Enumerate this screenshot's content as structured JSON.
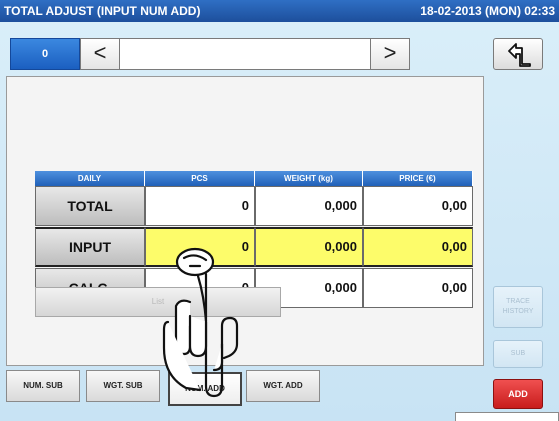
{
  "window": {
    "title": "TOTAL ADJUST (INPUT NUM ADD)",
    "datetime": "18-02-2013 (MON)  02:33"
  },
  "nav": {
    "index": "0",
    "prev_glyph": "<",
    "next_glyph": ">",
    "field_value": ""
  },
  "table": {
    "headers": [
      "DAILY",
      "PCS",
      "WEIGHT (kg)",
      "PRICE (€)"
    ],
    "rows": [
      {
        "label": "TOTAL",
        "pcs": "0",
        "weight": "0,000",
        "price": "0,00"
      },
      {
        "label": "INPUT",
        "pcs": "0",
        "weight": "0,000",
        "price": "0,00"
      },
      {
        "label": "CALC.",
        "pcs": "0",
        "weight": "0,000",
        "price": "0,00"
      }
    ],
    "highlight_color": "#fdfc6a"
  },
  "list_button": {
    "label": "List"
  },
  "side": {
    "trace_history_label": "TRACE HISTORY",
    "sub_label": "SUB",
    "add_label": "ADD",
    "add_color": "#d82828"
  },
  "tabs": [
    {
      "label": "NUM. SUB",
      "active": false
    },
    {
      "label": "WGT. SUB",
      "active": false
    },
    {
      "label": "NUM. ADD",
      "active": true
    },
    {
      "label": "WGT. ADD",
      "active": false
    }
  ],
  "colors": {
    "title_bar": "#1d4f9c",
    "background": "#d2e8f6",
    "accent_blue": "#2060b8"
  },
  "icons": {
    "back": "return-arrow-icon",
    "pointer": "pointing-hand-icon"
  }
}
